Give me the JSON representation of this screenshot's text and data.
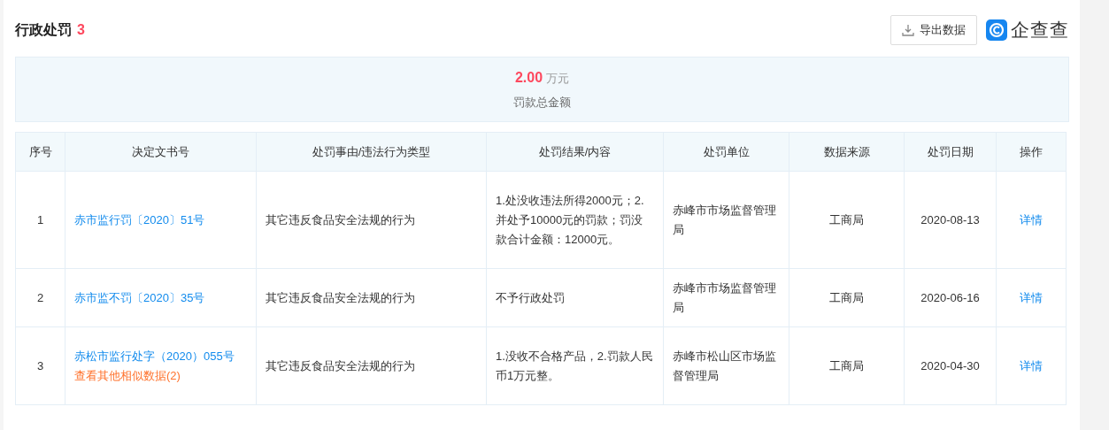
{
  "section": {
    "title": "行政处罚",
    "count": "3"
  },
  "export_button": {
    "label": "导出数据"
  },
  "brand": {
    "name": "企查查"
  },
  "summary": {
    "amount": "2.00",
    "unit": "万元",
    "label": "罚款总金额"
  },
  "table": {
    "columns": [
      "序号",
      "决定文书号",
      "处罚事由/违法行为类型",
      "处罚结果/内容",
      "处罚单位",
      "数据来源",
      "处罚日期",
      "操作"
    ],
    "rows": [
      {
        "index": "1",
        "doc_no": "赤市监行罚〔2020〕51号",
        "similar_link": null,
        "reason": "其它违反食品安全法规的行为",
        "result": "1.处没收违法所得2000元；2.并处予10000元的罚款；罚没款合计金额：12000元。",
        "authority": "赤峰市市场监督管理局",
        "source": "工商局",
        "date": "2020-08-13",
        "action": "详情"
      },
      {
        "index": "2",
        "doc_no": "赤市监不罚〔2020〕35号",
        "similar_link": null,
        "reason": "其它违反食品安全法规的行为",
        "result": "不予行政处罚",
        "authority": "赤峰市市场监督管理局",
        "source": "工商局",
        "date": "2020-06-16",
        "action": "详情"
      },
      {
        "index": "3",
        "doc_no": "赤松市监行处字（2020）055号",
        "similar_link": "查看其他相似数据(2)",
        "reason": "其它违反食品安全法规的行为",
        "result": "1.没收不合格产品，2.罚款人民币1万元整。",
        "authority": "赤峰市松山区市场监督管理局",
        "source": "工商局",
        "date": "2020-04-30",
        "action": "详情"
      }
    ]
  }
}
